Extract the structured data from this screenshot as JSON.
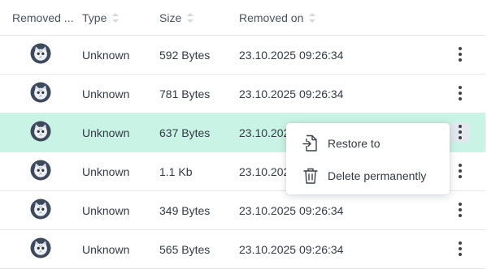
{
  "columns": {
    "removed_by": "Removed ...",
    "type": "Type",
    "size": "Size",
    "removed_on": "Removed on"
  },
  "rows": [
    {
      "type": "Unknown",
      "size": "592 Bytes",
      "removed_on": "23.10.2025 09:26:34"
    },
    {
      "type": "Unknown",
      "size": "781 Bytes",
      "removed_on": "23.10.2025 09:26:34"
    },
    {
      "type": "Unknown",
      "size": "637 Bytes",
      "removed_on": "23.10.202",
      "selected": true
    },
    {
      "type": "Unknown",
      "size": "1.1 Kb",
      "removed_on": "23.10.202"
    },
    {
      "type": "Unknown",
      "size": "349 Bytes",
      "removed_on": "23.10.2025 09:26:34"
    },
    {
      "type": "Unknown",
      "size": "565 Bytes",
      "removed_on": "23.10.2025 09:26:34"
    }
  ],
  "context_menu": {
    "restore_label": "Restore to",
    "delete_label": "Delete permanently"
  },
  "colors": {
    "selected_row": "#c9f3e4",
    "text": "#333a45"
  },
  "icons": [
    "avatar-cat-icon",
    "sort-icon",
    "more-vertical-icon",
    "restore-icon",
    "trash-icon"
  ]
}
